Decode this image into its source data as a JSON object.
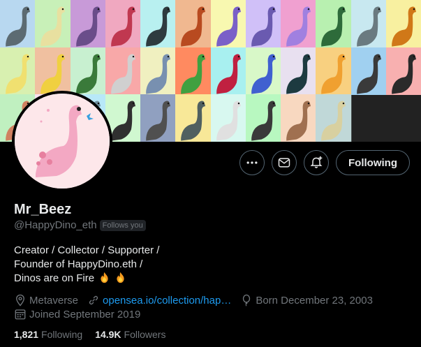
{
  "banner": {
    "tiles": [
      {
        "bg": "#b8d8f0",
        "dino": "#5c6b72"
      },
      {
        "bg": "#c8f0b8",
        "dino": "#e8e0a0"
      },
      {
        "bg": "#c89ad8",
        "dino": "#6a4d8a"
      },
      {
        "bg": "#f0a8c0",
        "dino": "#c03850"
      },
      {
        "bg": "#b8f0f0",
        "dino": "#2e3b3f"
      },
      {
        "bg": "#f0b890",
        "dino": "#b84a20"
      },
      {
        "bg": "#f8f8b0",
        "dino": "#7a60c8"
      },
      {
        "bg": "#d0c0f8",
        "dino": "#6a5ab0"
      },
      {
        "bg": "#f0a0d0",
        "dino": "#a080e0"
      },
      {
        "bg": "#b8f0b0",
        "dino": "#2d6b3a"
      },
      {
        "bg": "#c8e8f0",
        "dino": "#6a7a80"
      },
      {
        "bg": "#f8f0a0",
        "dino": "#d07818"
      },
      {
        "bg": "#d8f0b0",
        "dino": "#f0e070"
      },
      {
        "bg": "#f0c0a0",
        "dino": "#f0d040"
      },
      {
        "bg": "#c8f0d0",
        "dino": "#3a7a3a"
      },
      {
        "bg": "#f8a8a8",
        "dino": "#d0d0d0"
      },
      {
        "bg": "#f0f0c0",
        "dino": "#7890b0"
      },
      {
        "bg": "#ff8a60",
        "dino": "#40a040"
      },
      {
        "bg": "#a8f0f0",
        "dino": "#c02040"
      },
      {
        "bg": "#d8f8c8",
        "dino": "#4060d0"
      },
      {
        "bg": "#e8e0f0",
        "dino": "#1d3a40"
      },
      {
        "bg": "#f8d080",
        "dino": "#f0a030"
      },
      {
        "bg": "#a0d0f0",
        "dino": "#3a3a3a"
      },
      {
        "bg": "#f8b0b0",
        "dino": "#2a2a2a"
      },
      {
        "bg": "#c0f0c0",
        "dino": "#d08060"
      },
      {
        "bg": "#f8e0f0",
        "dino": "#b0b0b0"
      },
      {
        "bg": "#b8e8f8",
        "dino": "#7090a0"
      },
      {
        "bg": "#d0f8d0",
        "dino": "#303030"
      },
      {
        "bg": "#90a0c0",
        "dino": "#505050"
      },
      {
        "bg": "#f8e898",
        "dino": "#506060"
      },
      {
        "bg": "#d8f8f0",
        "dino": "#e0e0e0"
      },
      {
        "bg": "#b8f8c0",
        "dino": "#3a3a3a"
      },
      {
        "bg": "#f8d8c0",
        "dino": "#a07050"
      },
      {
        "bg": "#c0d8d8",
        "dino": "#d8d0a0"
      }
    ]
  },
  "avatar": {
    "bg": "#fde7ea",
    "dino": "#f3a8c3"
  },
  "actions": {
    "more_label": "More",
    "message_label": "Message",
    "notify_label": "Notify",
    "follow_label": "Following"
  },
  "profile": {
    "name": "Mr_Beez",
    "handle": "@HappyDino_eth",
    "follows_you": "Follows you",
    "bio_lines": [
      "Creator / Collector / Supporter /",
      "Founder of HappyDino.eth /",
      "Dinos are on Fire"
    ],
    "location": "Metaverse",
    "website": "opensea.io/collection/hap…",
    "birthday": "Born December 23, 2003",
    "joined": "Joined September 2019"
  },
  "stats": {
    "following_count": "1,821",
    "following_label": "Following",
    "followers_count": "14.9K",
    "followers_label": "Followers"
  },
  "colors": {
    "accent": "#1d9bf0",
    "secondary_text": "#71767b",
    "border": "#536471"
  }
}
